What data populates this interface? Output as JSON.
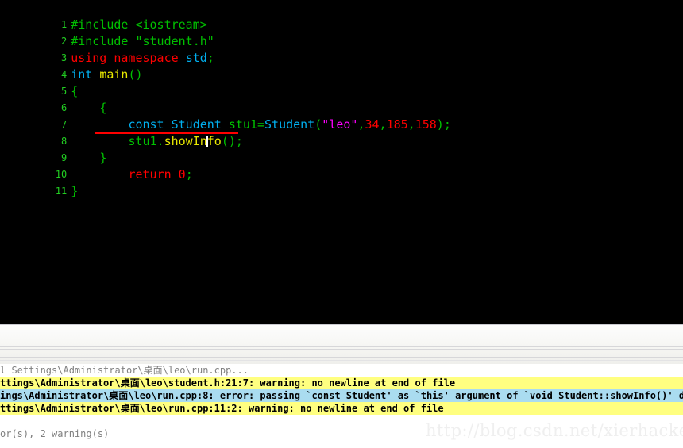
{
  "editor": {
    "background": "#000000",
    "gutter_color": "#00c000",
    "lines": [
      {
        "num": "1",
        "text": "#include <iostream>"
      },
      {
        "num": "2",
        "text": "#include \"student.h\""
      },
      {
        "num": "3",
        "text": "using namespace std;"
      },
      {
        "num": "4",
        "text": "int main()"
      },
      {
        "num": "5",
        "text": "{"
      },
      {
        "num": "6",
        "text": "    {"
      },
      {
        "num": "7",
        "text": "        const Student stu1=Student(\"leo\",34,185,158);"
      },
      {
        "num": "8",
        "text": "        stu1.showInfo();"
      },
      {
        "num": "9",
        "text": "    }"
      },
      {
        "num": "10",
        "text": "        return 0;"
      },
      {
        "num": "11",
        "text": "}"
      }
    ],
    "tokens": {
      "line1": {
        "directive": "#include <iostream>"
      },
      "line2": {
        "directive": "#include ",
        "string": "\"student.h\""
      },
      "line3": {
        "kw": "using namespace ",
        "type": "std",
        "punct": ";"
      },
      "line4": {
        "type": "int ",
        "fn": "main",
        "punct": "()"
      },
      "line5": {
        "brace": "{"
      },
      "line6": {
        "brace": "{"
      },
      "line7": {
        "kw": "const ",
        "type1": "Student ",
        "var": "stu1",
        "op": "=",
        "type2": "Student",
        "paren_open": "(",
        "string": "\"leo\"",
        "comma1": ",",
        "n1": "34",
        "comma2": ",",
        "n2": "185",
        "comma3": ",",
        "n3": "158",
        "paren_close": ")",
        "semi": ";"
      },
      "line8": {
        "obj": "stu1.",
        "method_a": "showIn",
        "method_b": "fo",
        "call": "();"
      },
      "line9": {
        "brace": "}"
      },
      "line10": {
        "kw": "return ",
        "num": "0",
        "semi": ";"
      },
      "line11": {
        "brace": "}"
      }
    },
    "colors": {
      "keyword": "#ff0000",
      "type": "#00b0f0",
      "string": "#ff00ff",
      "number": "#ff0000",
      "punctuation": "#00c000",
      "method": "#e8e800",
      "preprocessor": "#00c000",
      "error_underline": "#ff0000",
      "caret": "#ffffff"
    }
  },
  "console": {
    "rows": [
      {
        "kind": "plain",
        "text": "l Settings\\Administrator\\桌面\\leo\\run.cpp..."
      },
      {
        "kind": "warn",
        "text": "ttings\\Administrator\\桌面\\leo\\student.h:21:7: warning: no newline at end of file"
      },
      {
        "kind": "error",
        "text": "ings\\Administrator\\桌面\\leo\\run.cpp:8: error: passing `const Student' as `this' argument of `void Student::showInfo()' disca"
      },
      {
        "kind": "warn",
        "text": "ttings\\Administrator\\桌面\\leo\\run.cpp:11:2: warning: no newline at end of file"
      },
      {
        "kind": "spacer",
        "text": " "
      },
      {
        "kind": "summary",
        "text": "or(s), 2 warning(s)"
      }
    ],
    "colors": {
      "warning_bg": "#ffff80",
      "error_bg": "#aadcf0",
      "plain_text": "#808080"
    }
  },
  "watermark": {
    "text": "http://blog.csdn.net/xierhacker",
    "color": "#efefef"
  }
}
